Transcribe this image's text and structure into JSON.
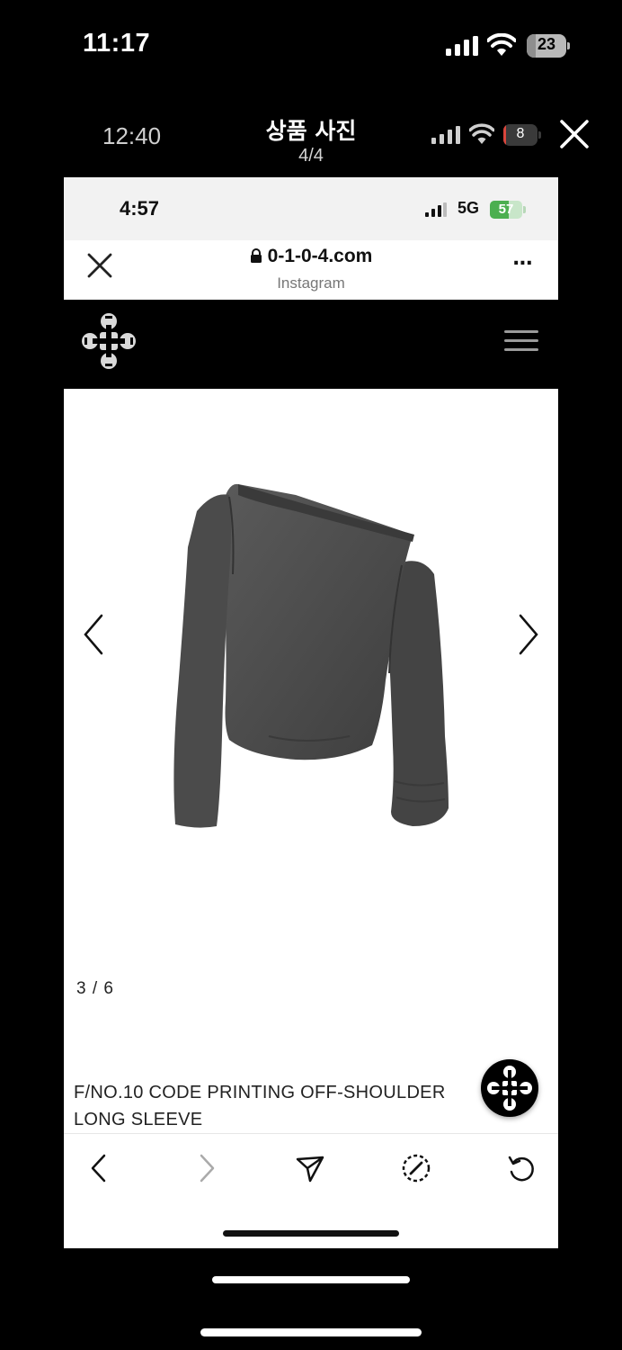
{
  "outer_status": {
    "time": "11:17",
    "battery": "23",
    "battery_level": 0.23
  },
  "viewer": {
    "inner_time": "12:40",
    "title": "상품 사진",
    "counter": "4/4",
    "battery": "8",
    "battery_level": 0.08
  },
  "screenshot": {
    "status": {
      "time": "4:57",
      "network": "5G",
      "battery": "57",
      "battery_level": 0.57
    },
    "browser": {
      "url": "0-1-0-4.com",
      "subtitle": "Instagram",
      "more": "..."
    },
    "site": {
      "logo": "brand-logo-icon",
      "menu": "hamburger-menu-icon"
    },
    "product": {
      "slide_counter": "3 / 6",
      "title": "F/NO.10 CODE PRINTING OFF-SHOULDER LONG SLEEVE",
      "image": "grey off-shoulder long sleeve top"
    },
    "toolbar": {
      "icons": [
        "back-arrow-icon",
        "forward-arrow-icon",
        "share-icon",
        "safari-compass-icon",
        "reload-icon"
      ]
    }
  },
  "colors": {
    "background": "#000000",
    "battery_green": "#4caf50",
    "battery_red": "#d9453c",
    "garment": "#4a4a4a"
  }
}
